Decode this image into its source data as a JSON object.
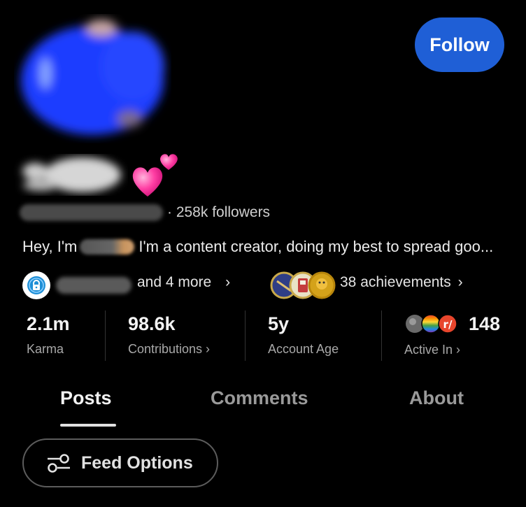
{
  "header": {
    "follow_label": "Follow"
  },
  "profile": {
    "followers_text": "· 258k followers",
    "bio_prefix": "Hey, I'm",
    "bio_suffix": "I'm a content creator, doing my best to spread goo..."
  },
  "badges": {
    "more_text": "and 4 more",
    "more_chevron": "›",
    "achievements_text": "38 achievements",
    "achievements_chevron": "›"
  },
  "stats": {
    "karma": {
      "value": "2.1m",
      "label": "Karma"
    },
    "contributions": {
      "value": "98.6k",
      "label": "Contributions ›"
    },
    "account_age": {
      "value": "5y",
      "label": "Account Age"
    },
    "active_in": {
      "value": "148",
      "label": "Active In ›"
    }
  },
  "tabs": [
    {
      "label": "Posts",
      "active": true
    },
    {
      "label": "Comments",
      "active": false
    },
    {
      "label": "About",
      "active": false
    }
  ],
  "feed": {
    "options_label": "Feed Options"
  },
  "colors": {
    "background": "#000000",
    "follow_button": "#1f5fd6",
    "heart": "#ff3fa4",
    "avatar_blur": "#2a4cff"
  }
}
